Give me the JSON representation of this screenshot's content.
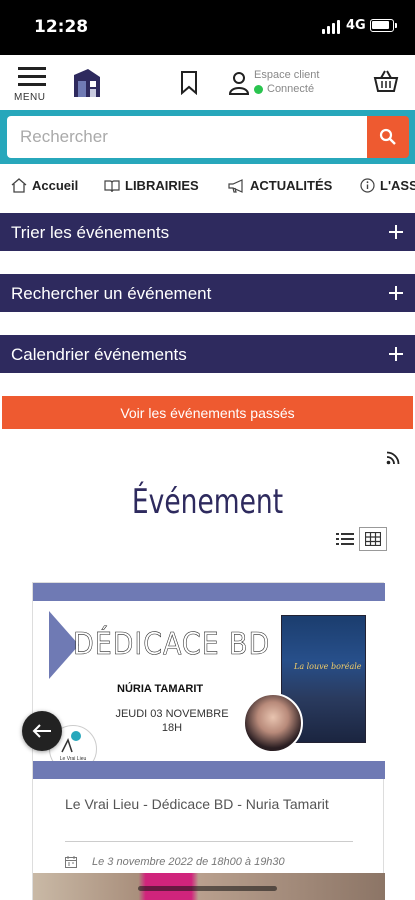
{
  "status_bar": {
    "time": "12:28",
    "network": "4G"
  },
  "header": {
    "menu_label": "MENU",
    "account_line1": "Espace client",
    "account_line2": "Connecté",
    "connected_color": "#2ac44f"
  },
  "search": {
    "placeholder": "Rechercher",
    "value": ""
  },
  "nav": {
    "items": [
      {
        "label": "Accueil",
        "icon": "home-icon"
      },
      {
        "label": "LIBRAIRIES",
        "icon": "book-icon"
      },
      {
        "label": "ACTUALITÉS",
        "icon": "megaphone-icon"
      },
      {
        "label": "L'ASS",
        "icon": "info-icon"
      }
    ]
  },
  "accordions": [
    {
      "label": "Trier les événements"
    },
    {
      "label": "Rechercher un événement"
    },
    {
      "label": "Calendrier événements"
    }
  ],
  "past_events_button": "Voir les événements passés",
  "section_title": "Événement",
  "view_toggle": {
    "active": "grid"
  },
  "event": {
    "image": {
      "headline": "DÉDICACE BD",
      "author": "NÚRIA TAMARIT",
      "date_line1": "JEUDI 03 NOVEMBRE",
      "date_line2": "18H",
      "book_title": "La louve boréale",
      "shop_logo_text": "Le Vrai Lieu"
    },
    "title": "Le Vrai Lieu - Dédicace BD - Nuria Tamarit",
    "date": "Le 3 novembre 2022 de 18h00 à 19h30"
  },
  "colors": {
    "primary_dark": "#2e2a5e",
    "accent_orange": "#ee5a30",
    "search_teal": "#27a7bb",
    "banner_blue": "#6f7ab4"
  }
}
